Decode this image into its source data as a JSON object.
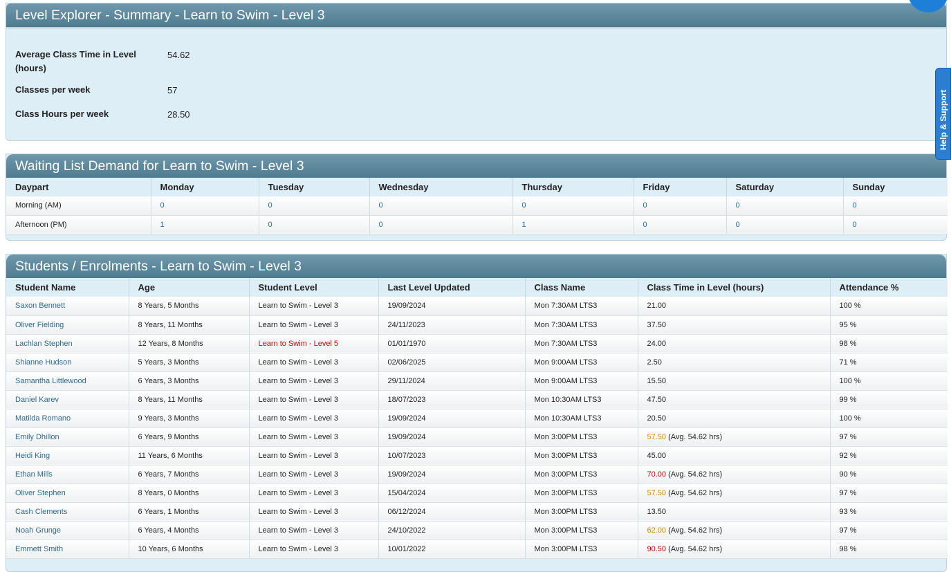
{
  "summary": {
    "title": "Level Explorer - Summary - Learn to Swim - Level 3",
    "rows": [
      {
        "label": "Average Class Time in Level (hours)",
        "value": "54.62"
      },
      {
        "label": "Classes per week",
        "value": "57"
      },
      {
        "label": "Class Hours per week",
        "value": "28.50"
      }
    ]
  },
  "waiting": {
    "title": "Waiting List Demand for Learn to Swim - Level 3",
    "headers": [
      "Daypart",
      "Monday",
      "Tuesday",
      "Wednesday",
      "Thursday",
      "Friday",
      "Saturday",
      "Sunday"
    ],
    "rows": [
      {
        "daypart": "Morning (AM)",
        "values": [
          "0",
          "0",
          "0",
          "0",
          "0",
          "0",
          "0"
        ]
      },
      {
        "daypart": "Afternoon (PM)",
        "values": [
          "1",
          "0",
          "0",
          "1",
          "0",
          "0",
          "0"
        ]
      }
    ]
  },
  "students": {
    "title": "Students / Enrolments - Learn to Swim - Level 3",
    "headers": [
      "Student Name",
      "Age",
      "Student Level",
      "Last Level Updated",
      "Class Name",
      "Class Time in Level (hours)",
      "Attendance %"
    ],
    "rows": [
      {
        "name": "Saxon Bennett",
        "age": "8 Years, 5 Months",
        "level": "Learn to Swim - Level 3",
        "updated": "19/09/2024",
        "class": "Mon 7:30AM LTS3",
        "time": "21.00",
        "avg": "",
        "attendance": "100 %"
      },
      {
        "name": "Oliver Fielding",
        "age": "8 Years, 11 Months",
        "level": "Learn to Swim - Level 3",
        "updated": "24/11/2023",
        "class": "Mon 7:30AM LTS3",
        "time": "37.50",
        "avg": "",
        "attendance": "95 %"
      },
      {
        "name": "Lachlan Stephen",
        "age": "12 Years, 8 Months",
        "level": "Learn to Swim - Level 5",
        "updated": "01/01/1970",
        "class": "Mon 7:30AM LTS3",
        "time": "24.00",
        "avg": "",
        "attendance": "98 %"
      },
      {
        "name": "Shianne Hudson",
        "age": "5 Years, 3 Months",
        "level": "Learn to Swim - Level 3",
        "updated": "02/06/2025",
        "class": "Mon 9:00AM LTS3",
        "time": "2.50",
        "avg": "",
        "attendance": "71 %"
      },
      {
        "name": "Samantha Littlewood",
        "age": "6 Years, 3 Months",
        "level": "Learn to Swim - Level 3",
        "updated": "29/11/2024",
        "class": "Mon 9:00AM LTS3",
        "time": "15.50",
        "avg": "",
        "attendance": "100 %"
      },
      {
        "name": "Daniel Karev",
        "age": "8 Years, 11 Months",
        "level": "Learn to Swim - Level 3",
        "updated": "18/07/2023",
        "class": "Mon 10:30AM LTS3",
        "time": "47.50",
        "avg": "",
        "attendance": "99 %"
      },
      {
        "name": "Matilda Romano",
        "age": "9 Years, 3 Months",
        "level": "Learn to Swim - Level 3",
        "updated": "19/09/2024",
        "class": "Mon 10:30AM LTS3",
        "time": "20.50",
        "avg": "",
        "attendance": "100 %"
      },
      {
        "name": "Emily Dhillon",
        "age": "6 Years, 9 Months",
        "level": "Learn to Swim - Level 3",
        "updated": "19/09/2024",
        "class": "Mon 3:00PM LTS3",
        "time": "57.50",
        "avg": "(Avg. 54.62 hrs)",
        "attendance": "97 %"
      },
      {
        "name": "Heidi King",
        "age": "11 Years, 6 Months",
        "level": "Learn to Swim - Level 3",
        "updated": "10/07/2023",
        "class": "Mon 3:00PM LTS3",
        "time": "45.00",
        "avg": "",
        "attendance": "92 %"
      },
      {
        "name": "Ethan Mills",
        "age": "6 Years, 7 Months",
        "level": "Learn to Swim - Level 3",
        "updated": "19/09/2024",
        "class": "Mon 3:00PM LTS3",
        "time": "70.00",
        "avg": "(Avg. 54.62 hrs)",
        "attendance": "90 %"
      },
      {
        "name": "Oliver Stephen",
        "age": "8 Years, 0 Months",
        "level": "Learn to Swim - Level 3",
        "updated": "15/04/2024",
        "class": "Mon 3:00PM LTS3",
        "time": "57.50",
        "avg": "(Avg. 54.62 hrs)",
        "attendance": "97 %"
      },
      {
        "name": "Cash Clements",
        "age": "6 Years, 1 Months",
        "level": "Learn to Swim - Level 3",
        "updated": "06/12/2024",
        "class": "Mon 3:00PM LTS3",
        "time": "13.50",
        "avg": "",
        "attendance": "93 %"
      },
      {
        "name": "Noah Grunge",
        "age": "6 Years, 4 Months",
        "level": "Learn to Swim - Level 3",
        "updated": "24/10/2022",
        "class": "Mon 3:00PM LTS3",
        "time": "62.00",
        "avg": "(Avg. 54.62 hrs)",
        "attendance": "97 %"
      },
      {
        "name": "Emmett Smith",
        "age": "10 Years, 6 Months",
        "level": "Learn to Swim - Level 3",
        "updated": "10/01/2022",
        "class": "Mon 3:00PM LTS3",
        "time": "90.50",
        "avg": "(Avg. 54.62 hrs)",
        "attendance": "98 %"
      }
    ]
  },
  "help_tab": {
    "label": "Help & Support",
    "color": "#2c7fd0"
  },
  "chat_widget": {
    "icon": "chat-bubble-icon",
    "color": "#1e7fd8"
  },
  "colors": {
    "header": "#5a8599",
    "panel_bg": "#deeef6",
    "link": "#2e6a93",
    "warning": "#d08a00",
    "alert": "#d40000"
  }
}
